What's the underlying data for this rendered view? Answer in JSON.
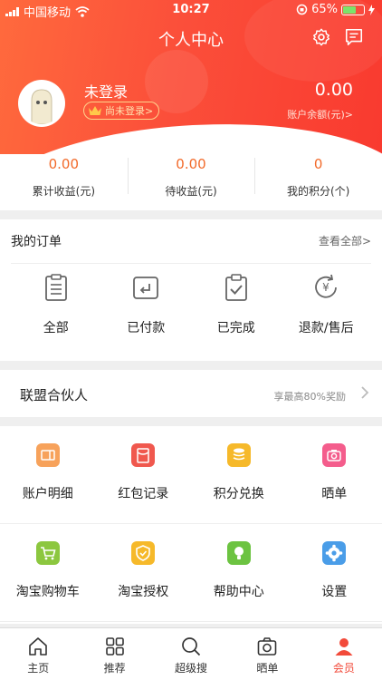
{
  "status": {
    "carrier": "中国移动",
    "time": "10:27",
    "battery": "65%",
    "battery_level": 0.65
  },
  "header": {
    "title": "个人中心"
  },
  "profile": {
    "name": "未登录",
    "badge": "尚未登录>",
    "balance": "0.00",
    "balance_label": "账户余额(元)>"
  },
  "stats": [
    {
      "value": "0.00",
      "label": "累计收益(元)"
    },
    {
      "value": "0.00",
      "label": "待收益(元)"
    },
    {
      "value": "0",
      "label": "我的积分(个)"
    }
  ],
  "orders": {
    "title": "我的订单",
    "more": "查看全部>",
    "items": [
      {
        "label": "全部",
        "icon": "clipboard-icon"
      },
      {
        "label": "已付款",
        "icon": "paid-icon"
      },
      {
        "label": "已完成",
        "icon": "completed-icon"
      },
      {
        "label": "退款/售后",
        "icon": "refund-icon"
      }
    ]
  },
  "partner": {
    "title": "联盟合伙人",
    "subtitle": "享最高80%奖励"
  },
  "grid": [
    {
      "label": "账户明细",
      "icon": "account-detail-icon",
      "color": "#f7a25b"
    },
    {
      "label": "红包记录",
      "icon": "red-packet-icon",
      "color": "#f0584e"
    },
    {
      "label": "积分兑换",
      "icon": "coins-icon",
      "color": "#f6b92a"
    },
    {
      "label": "晒单",
      "icon": "camera-icon",
      "color": "#f45d8c"
    },
    {
      "label": "淘宝购物车",
      "icon": "cart-icon",
      "color": "#8cc73f"
    },
    {
      "label": "淘宝授权",
      "icon": "shield-icon",
      "color": "#f6b92a"
    },
    {
      "label": "帮助中心",
      "icon": "bulb-icon",
      "color": "#6cc341"
    },
    {
      "label": "设置",
      "icon": "settings-icon",
      "color": "#4a9de8"
    }
  ],
  "tabs": [
    {
      "label": "主页",
      "icon": "home-icon"
    },
    {
      "label": "推荐",
      "icon": "grid-icon"
    },
    {
      "label": "超级搜",
      "icon": "search-icon"
    },
    {
      "label": "晒单",
      "icon": "camera-icon"
    },
    {
      "label": "会员",
      "icon": "user-icon"
    }
  ]
}
